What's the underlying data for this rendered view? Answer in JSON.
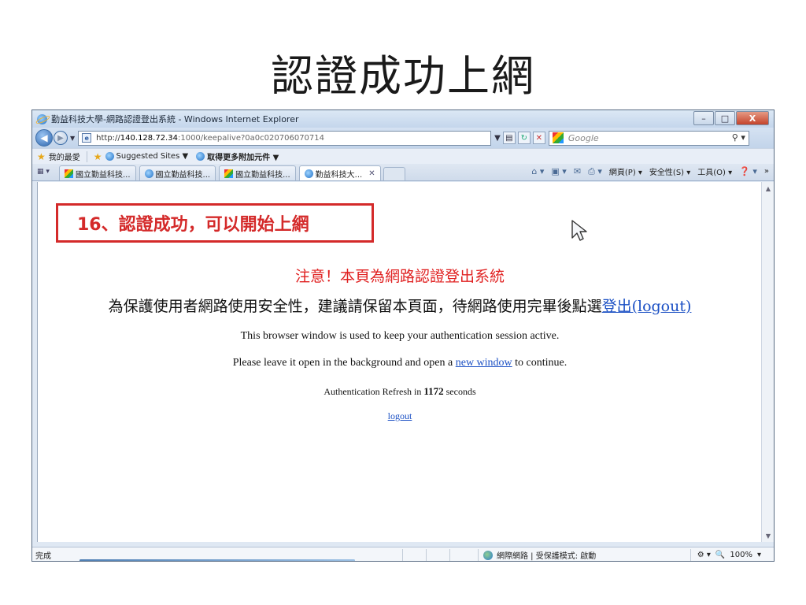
{
  "slide": {
    "title": "認證成功上網"
  },
  "window": {
    "title": "勤益科技大學-網路認證登出系統 - Windows Internet Explorer",
    "controls": {
      "minimize": "–",
      "maximize": "□",
      "close": "X"
    }
  },
  "address": {
    "url_prefix": "http://",
    "url_host": "140.128.72.34",
    "url_path": ":1000/keepalive?0a0c020706070714",
    "search_placeholder": "Google"
  },
  "favorites": {
    "label": "我的最愛",
    "items": [
      {
        "label": "Suggested Sites ▼"
      },
      {
        "label": "取得更多附加元件 ▼"
      }
    ]
  },
  "tabs": [
    {
      "label": "國立勤益科技..."
    },
    {
      "label": "國立勤益科技..."
    },
    {
      "label": "國立勤益科技..."
    },
    {
      "label": "勤益科技大...",
      "active": true
    }
  ],
  "commands": {
    "page": "網頁(P) ▾",
    "safety": "安全性(S) ▾",
    "tools": "工具(O) ▾",
    "overflow": "»"
  },
  "content": {
    "callout": "16、認證成功，可以開始上網",
    "notice_title": "注意！本頁為網路認證登出系統",
    "notice_line": "為保護使用者網路使用安全性，建議請保留本頁面，待網路使用完畢後點選",
    "notice_link": "登出(logout)",
    "info1": "This browser window is used to keep your authentication session active.",
    "info2_before": "Please leave it open in the background and open a ",
    "info2_link": "new window",
    "info2_after": " to continue.",
    "refresh_before": "Authentication Refresh in ",
    "refresh_seconds": "1172",
    "refresh_after": " seconds",
    "logout_link": "logout"
  },
  "status": {
    "text": "完成",
    "zone": "網際網路 | 受保護模式: 啟動",
    "zoom": "100%"
  },
  "colors": {
    "callout_red": "#d42a2a",
    "notice_red": "#e02020",
    "link_blue": "#1a4fc4"
  }
}
